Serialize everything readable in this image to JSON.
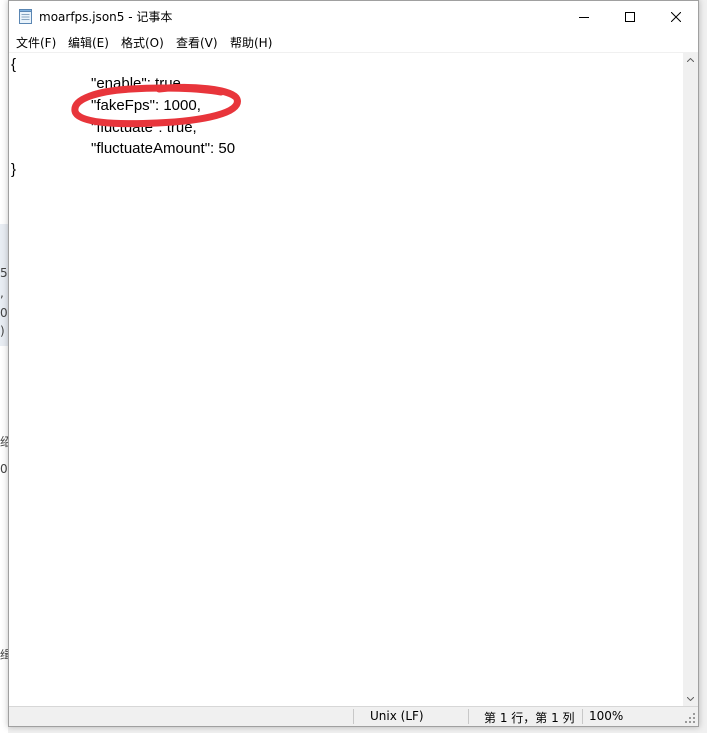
{
  "window": {
    "title": "moarfps.json5 - 记事本",
    "icon": "notepad-icon",
    "controls": {
      "minimize": "minimize-icon",
      "maximize": "maximize-icon",
      "close": "close-icon"
    }
  },
  "menu": {
    "items": [
      {
        "label": "文件(F)"
      },
      {
        "label": "编辑(E)"
      },
      {
        "label": "格式(O)"
      },
      {
        "label": "查看(V)"
      },
      {
        "label": "帮助(H)"
      }
    ]
  },
  "editor": {
    "lines": [
      "{",
      "\"enable\": true,",
      "\"fakeFps\": 1000,",
      "\"fluctuate\": true,",
      "\"fluctuateAmount\": 50",
      "}"
    ]
  },
  "annotation": {
    "color": "#e8353b",
    "shape": "hand-drawn-ellipse"
  },
  "status": {
    "line_ending": "Unix (LF)",
    "cursor": "第 1 行，第 1 列",
    "zoom": "100%"
  },
  "background": {
    "fragments": [
      "5",
      ",",
      "0",
      ")",
      "绍",
      "0",
      "缉"
    ]
  }
}
